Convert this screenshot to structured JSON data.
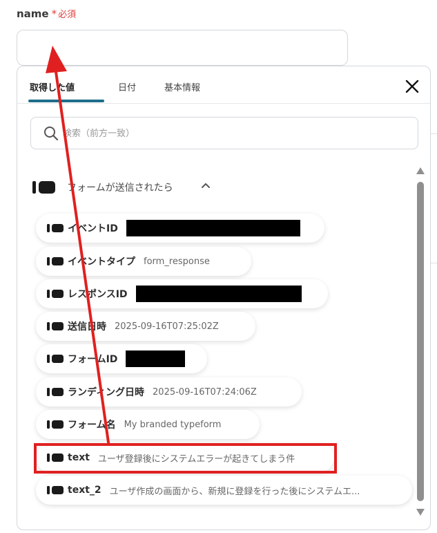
{
  "field": {
    "label": "name",
    "required_mark": "*",
    "required_text": "必須",
    "value": ""
  },
  "tabs": [
    {
      "label": "取得した値",
      "active": true
    },
    {
      "label": "日付",
      "active": false
    },
    {
      "label": "基本情報",
      "active": false
    }
  ],
  "search": {
    "placeholder": "検索（前方一致）",
    "value": ""
  },
  "group": {
    "title": "フォームが送信されたら",
    "icon": "chip-icon",
    "expanded": true
  },
  "items": [
    {
      "label": "イベントID",
      "value": "",
      "redacted": true
    },
    {
      "label": "イベントタイプ",
      "value": "form_response",
      "redacted": false
    },
    {
      "label": "レスポンスID",
      "value": "",
      "redacted": true
    },
    {
      "label": "送信日時",
      "value": "2025-09-16T07:25:02Z",
      "redacted": false
    },
    {
      "label": "フォームID",
      "value": "",
      "redacted": true
    },
    {
      "label": "ランディング日時",
      "value": "2025-09-16T07:24:06Z",
      "redacted": false
    },
    {
      "label": "フォーム名",
      "value": "My branded typeform",
      "redacted": false
    },
    {
      "label": "text",
      "value": "ユーザ登録後にシステムエラーが起きてしまう件",
      "redacted": false,
      "highlighted": true
    },
    {
      "label": "text_2",
      "value": "ユーザ作成の画面から、新規に登録を行った後にシステムエ...",
      "redacted": false
    }
  ],
  "colors": {
    "accent": "#1e6e8a",
    "required": "#e23e3e",
    "annotation": "#e02020",
    "scrollbar": "#8f8f8f"
  }
}
